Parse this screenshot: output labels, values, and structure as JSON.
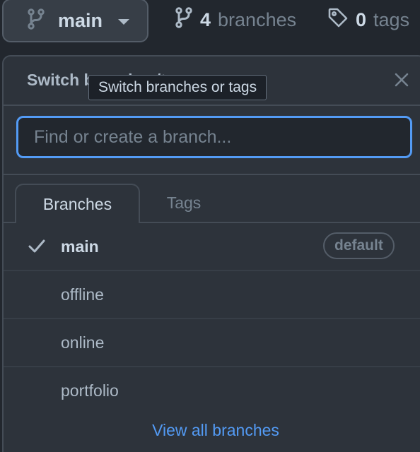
{
  "top_bar": {
    "current_branch": "main",
    "branch_count": "4",
    "branch_label": "branches",
    "tag_count": "0",
    "tag_label": "tags"
  },
  "panel": {
    "title": "Switch branches/tags",
    "close_icon": "close-icon",
    "tooltip": "Switch branches or tags",
    "search": {
      "value": "",
      "placeholder": "Find or create a branch..."
    },
    "tabs": [
      {
        "label": "Branches",
        "active": true
      },
      {
        "label": "Tags",
        "active": false
      }
    ],
    "branches": [
      {
        "name": "main",
        "selected": true,
        "badge": "default"
      },
      {
        "name": "offline",
        "selected": false
      },
      {
        "name": "online",
        "selected": false
      },
      {
        "name": "portfolio",
        "selected": false
      }
    ],
    "footer_link": "View all branches"
  },
  "colors": {
    "background": "#22272e",
    "panel": "#2d333b",
    "accent": "#539bf5",
    "text": "#adbac7",
    "muted": "#768390"
  }
}
